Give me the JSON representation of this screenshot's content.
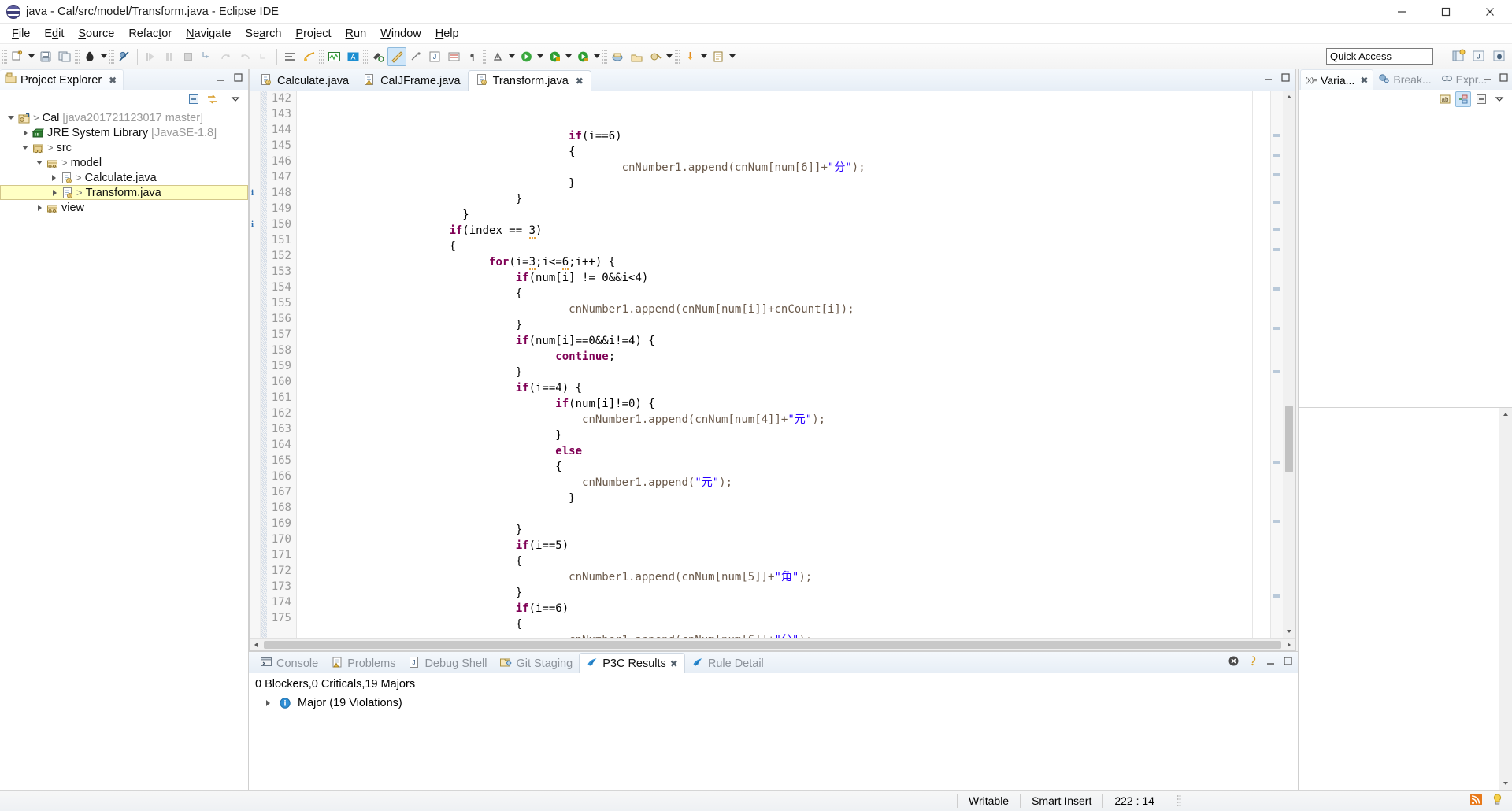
{
  "window": {
    "title": "java - Cal/src/model/Transform.java - Eclipse IDE",
    "app_icon": "eclipse-icon",
    "minimize": "─",
    "maximize": "☐",
    "close": "✕"
  },
  "menubar": {
    "items": [
      "File",
      "Edit",
      "Source",
      "Refactor",
      "Navigate",
      "Search",
      "Project",
      "Run",
      "Window",
      "Help"
    ]
  },
  "toolbar": {
    "quick_access_placeholder": "Quick Access",
    "quick_access_value": "Quick Access"
  },
  "project_explorer": {
    "tab_label": "Project Explorer",
    "close_glyph": "✖",
    "tree": [
      {
        "indent": 0,
        "twisty": "down",
        "icon": "java-project-icon",
        "arrow": ">",
        "label": "Cal",
        "dim": "[java201721123017 master]",
        "selected": false
      },
      {
        "indent": 1,
        "twisty": "right",
        "icon": "library-icon",
        "arrow": "",
        "label": "JRE System Library",
        "dim": "[JavaSE-1.8]",
        "selected": false
      },
      {
        "indent": 1,
        "twisty": "down",
        "icon": "source-folder-icon",
        "arrow": ">",
        "label": "src",
        "dim": "",
        "selected": false
      },
      {
        "indent": 2,
        "twisty": "down",
        "icon": "package-icon",
        "arrow": ">",
        "label": "model",
        "dim": "",
        "selected": false
      },
      {
        "indent": 3,
        "twisty": "right",
        "icon": "java-file-icon",
        "arrow": ">",
        "label": "Calculate.java",
        "dim": "",
        "selected": false
      },
      {
        "indent": 3,
        "twisty": "right",
        "icon": "java-file-icon",
        "arrow": ">",
        "label": "Transform.java",
        "dim": "",
        "selected": true
      },
      {
        "indent": 2,
        "twisty": "right",
        "icon": "package-icon",
        "arrow": "",
        "label": "view",
        "dim": "",
        "selected": false
      }
    ]
  },
  "editor": {
    "tabs": [
      {
        "label": "Calculate.java",
        "active": false,
        "icon": "java-file-icon",
        "dirty": false
      },
      {
        "label": "CalJFrame.java",
        "active": false,
        "icon": "java-file-warn-icon",
        "dirty": false
      },
      {
        "label": "Transform.java",
        "active": true,
        "icon": "java-file-icon",
        "dirty": false
      }
    ],
    "close_glyph": "✖",
    "first_line_number": 142,
    "lines": [
      {
        "n": 142,
        "indent": 20,
        "tokens": [
          {
            "t": "if",
            "c": "kw"
          },
          {
            "t": "(i==6)",
            "c": "op"
          }
        ],
        "marker": ""
      },
      {
        "n": 143,
        "indent": 20,
        "tokens": [
          {
            "t": "{",
            "c": "op"
          }
        ],
        "marker": ""
      },
      {
        "n": 144,
        "indent": 24,
        "tokens": [
          {
            "t": "cnNumber1",
            "c": "pl"
          },
          {
            "t": ".append(",
            "c": "pl"
          },
          {
            "t": "cnNum",
            "c": "pl"
          },
          {
            "t": "[",
            "c": "pl"
          },
          {
            "t": "num",
            "c": "pl"
          },
          {
            "t": "[6]]+",
            "c": "pl"
          },
          {
            "t": "\"分\"",
            "c": "str"
          },
          {
            "t": ");",
            "c": "pl"
          }
        ],
        "marker": ""
      },
      {
        "n": 145,
        "indent": 20,
        "tokens": [
          {
            "t": "}",
            "c": "op"
          }
        ],
        "marker": ""
      },
      {
        "n": 146,
        "indent": 16,
        "tokens": [
          {
            "t": "}",
            "c": "op"
          }
        ],
        "marker": ""
      },
      {
        "n": 147,
        "indent": 12,
        "tokens": [
          {
            "t": "}",
            "c": "op"
          }
        ],
        "marker": ""
      },
      {
        "n": 148,
        "indent": 11,
        "tokens": [
          {
            "t": "if",
            "c": "kw"
          },
          {
            "t": "(index == ",
            "c": "op"
          },
          {
            "t": "3",
            "c": "warnu"
          },
          {
            "t": ")",
            "c": "op"
          }
        ],
        "marker": "info"
      },
      {
        "n": 149,
        "indent": 11,
        "tokens": [
          {
            "t": "{",
            "c": "op"
          }
        ],
        "marker": ""
      },
      {
        "n": 150,
        "indent": 14,
        "tokens": [
          {
            "t": "for",
            "c": "kw"
          },
          {
            "t": "(i=",
            "c": "op"
          },
          {
            "t": "3",
            "c": "warnu"
          },
          {
            "t": ";i<=",
            "c": "op"
          },
          {
            "t": "6",
            "c": "warnu"
          },
          {
            "t": ";i++) {",
            "c": "op"
          }
        ],
        "marker": "info"
      },
      {
        "n": 151,
        "indent": 16,
        "tokens": [
          {
            "t": "if",
            "c": "kw"
          },
          {
            "t": "(num[i] != 0&&i<4)",
            "c": "op"
          }
        ],
        "marker": ""
      },
      {
        "n": 152,
        "indent": 16,
        "tokens": [
          {
            "t": "{",
            "c": "op"
          }
        ],
        "marker": ""
      },
      {
        "n": 153,
        "indent": 20,
        "tokens": [
          {
            "t": "cnNumber1.append(",
            "c": "pl"
          },
          {
            "t": "cnNum",
            "c": "pl"
          },
          {
            "t": "[",
            "c": "pl"
          },
          {
            "t": "num",
            "c": "pl"
          },
          {
            "t": "[i]]+",
            "c": "pl"
          },
          {
            "t": "cnCount",
            "c": "pl"
          },
          {
            "t": "[i]);",
            "c": "pl"
          }
        ],
        "marker": ""
      },
      {
        "n": 154,
        "indent": 16,
        "tokens": [
          {
            "t": "}",
            "c": "op"
          }
        ],
        "marker": ""
      },
      {
        "n": 155,
        "indent": 16,
        "tokens": [
          {
            "t": "if",
            "c": "kw"
          },
          {
            "t": "(num[i]==0&&i!=4) {",
            "c": "op"
          }
        ],
        "marker": ""
      },
      {
        "n": 156,
        "indent": 19,
        "tokens": [
          {
            "t": "continue",
            "c": "kw"
          },
          {
            "t": ";",
            "c": "op"
          }
        ],
        "marker": ""
      },
      {
        "n": 157,
        "indent": 16,
        "tokens": [
          {
            "t": "}",
            "c": "op"
          }
        ],
        "marker": ""
      },
      {
        "n": 158,
        "indent": 16,
        "tokens": [
          {
            "t": "if",
            "c": "kw"
          },
          {
            "t": "(i==4) {",
            "c": "op"
          }
        ],
        "marker": ""
      },
      {
        "n": 159,
        "indent": 19,
        "tokens": [
          {
            "t": "if",
            "c": "kw"
          },
          {
            "t": "(num[i]!=0) {",
            "c": "op"
          }
        ],
        "marker": ""
      },
      {
        "n": 160,
        "indent": 21,
        "tokens": [
          {
            "t": "cnNumber1.append(",
            "c": "pl"
          },
          {
            "t": "cnNum",
            "c": "pl"
          },
          {
            "t": "[",
            "c": "pl"
          },
          {
            "t": "num",
            "c": "pl"
          },
          {
            "t": "[4]]+",
            "c": "pl"
          },
          {
            "t": "\"元\"",
            "c": "str"
          },
          {
            "t": ");",
            "c": "pl"
          }
        ],
        "marker": ""
      },
      {
        "n": 161,
        "indent": 19,
        "tokens": [
          {
            "t": "}",
            "c": "op"
          }
        ],
        "marker": ""
      },
      {
        "n": 162,
        "indent": 19,
        "tokens": [
          {
            "t": "else",
            "c": "kw"
          }
        ],
        "marker": ""
      },
      {
        "n": 163,
        "indent": 19,
        "tokens": [
          {
            "t": "{",
            "c": "op"
          }
        ],
        "marker": ""
      },
      {
        "n": 164,
        "indent": 21,
        "tokens": [
          {
            "t": "cnNumber1.append(",
            "c": "pl"
          },
          {
            "t": "\"元\"",
            "c": "str"
          },
          {
            "t": ");",
            "c": "pl"
          }
        ],
        "marker": ""
      },
      {
        "n": 165,
        "indent": 20,
        "tokens": [
          {
            "t": "}",
            "c": "op"
          }
        ],
        "marker": ""
      },
      {
        "n": 166,
        "indent": 0,
        "tokens": [],
        "marker": ""
      },
      {
        "n": 167,
        "indent": 16,
        "tokens": [
          {
            "t": "}",
            "c": "op"
          }
        ],
        "marker": ""
      },
      {
        "n": 168,
        "indent": 16,
        "tokens": [
          {
            "t": "if",
            "c": "kw"
          },
          {
            "t": "(i==5)",
            "c": "op"
          }
        ],
        "marker": ""
      },
      {
        "n": 169,
        "indent": 16,
        "tokens": [
          {
            "t": "{",
            "c": "op"
          }
        ],
        "marker": ""
      },
      {
        "n": 170,
        "indent": 20,
        "tokens": [
          {
            "t": "cnNumber1.append(",
            "c": "pl"
          },
          {
            "t": "cnNum",
            "c": "pl"
          },
          {
            "t": "[",
            "c": "pl"
          },
          {
            "t": "num",
            "c": "pl"
          },
          {
            "t": "[5]]+",
            "c": "pl"
          },
          {
            "t": "\"角\"",
            "c": "str"
          },
          {
            "t": ");",
            "c": "pl"
          }
        ],
        "marker": ""
      },
      {
        "n": 171,
        "indent": 16,
        "tokens": [
          {
            "t": "}",
            "c": "op"
          }
        ],
        "marker": ""
      },
      {
        "n": 172,
        "indent": 16,
        "tokens": [
          {
            "t": "if",
            "c": "kw"
          },
          {
            "t": "(i==6)",
            "c": "op"
          }
        ],
        "marker": ""
      },
      {
        "n": 173,
        "indent": 16,
        "tokens": [
          {
            "t": "{",
            "c": "op"
          }
        ],
        "marker": ""
      },
      {
        "n": 174,
        "indent": 20,
        "tokens": [
          {
            "t": "cnNumber1.append(",
            "c": "pl"
          },
          {
            "t": "cnNum",
            "c": "pl"
          },
          {
            "t": "[",
            "c": "pl"
          },
          {
            "t": "num",
            "c": "pl"
          },
          {
            "t": "[6]]+",
            "c": "pl"
          },
          {
            "t": "\"分\"",
            "c": "str"
          },
          {
            "t": ");",
            "c": "pl"
          }
        ],
        "marker": ""
      },
      {
        "n": 175,
        "indent": 16,
        "tokens": [
          {
            "t": "}",
            "c": "op"
          }
        ],
        "marker": ""
      }
    ]
  },
  "debug_views": {
    "tabs": [
      {
        "label": "Varia...",
        "active": true,
        "icon": "variables-icon",
        "close": "✖"
      },
      {
        "label": "Break...",
        "active": false,
        "icon": "breakpoints-icon",
        "close": ""
      },
      {
        "label": "Expr...",
        "active": false,
        "icon": "expressions-icon",
        "close": ""
      }
    ]
  },
  "bottom_panel": {
    "tabs": [
      {
        "label": "Console",
        "active": false,
        "icon": "console-icon"
      },
      {
        "label": "Problems",
        "active": false,
        "icon": "problems-icon"
      },
      {
        "label": "Debug Shell",
        "active": false,
        "icon": "debug-shell-icon"
      },
      {
        "label": "Git Staging",
        "active": false,
        "icon": "git-staging-icon"
      },
      {
        "label": "P3C Results",
        "active": true,
        "icon": "p3c-icon"
      },
      {
        "label": "Rule Detail",
        "active": false,
        "icon": "p3c-icon"
      }
    ],
    "close_glyph": "✖",
    "summary": "0 Blockers,0 Criticals,19 Majors",
    "rows": [
      {
        "twisty": "right",
        "icon": "info-icon",
        "label": "Major (19 Violations)"
      }
    ]
  },
  "statusbar": {
    "writable": "Writable",
    "insert_mode": "Smart Insert",
    "position": "222 : 14"
  },
  "colors": {
    "keyword": "#7f0055",
    "string": "#2a00ff",
    "plain": "#6b5a4b",
    "selection": "#ffffc4",
    "tab_active_bg": "#ffffff",
    "accent_blue": "#3c7fb1"
  }
}
